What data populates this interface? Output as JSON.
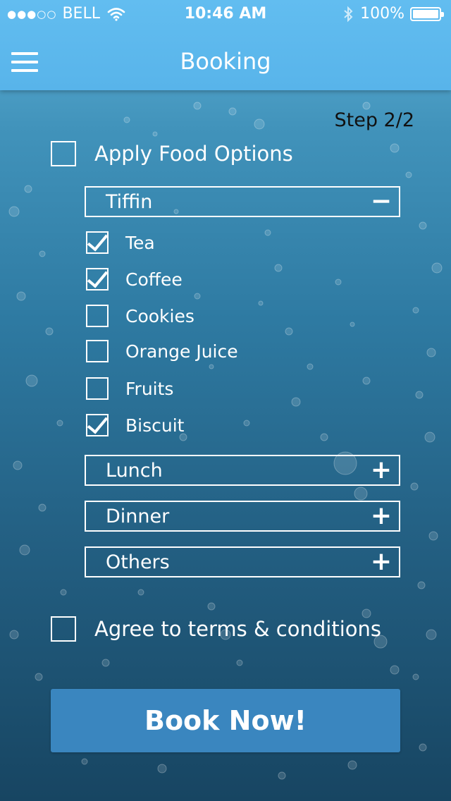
{
  "status_bar": {
    "signal": "●●●○○",
    "carrier": "BELL",
    "time": "10:46 AM",
    "battery_pct": "100%"
  },
  "nav": {
    "title": "Booking"
  },
  "step": "Step 2/2",
  "apply_food": {
    "label": "Apply Food Options",
    "checked": false
  },
  "sections": [
    {
      "label": "Tiffin",
      "toggle": "−",
      "expanded": true,
      "items": [
        {
          "label": "Tea",
          "checked": true
        },
        {
          "label": "Coffee",
          "checked": true
        },
        {
          "label": "Cookies",
          "checked": false
        },
        {
          "label": "Orange Juice",
          "checked": false
        },
        {
          "label": "Fruits",
          "checked": false
        },
        {
          "label": "Biscuit",
          "checked": true
        }
      ]
    },
    {
      "label": "Lunch",
      "toggle": "+",
      "expanded": false
    },
    {
      "label": "Dinner",
      "toggle": "+",
      "expanded": false
    },
    {
      "label": "Others",
      "toggle": "+",
      "expanded": false
    }
  ],
  "terms": {
    "label": "Agree to terms & conditions",
    "checked": false
  },
  "book_button": "Book Now!",
  "colors": {
    "nav_bar": "#5bb7ec",
    "button": "#3a86bf",
    "text": "#ffffff"
  }
}
